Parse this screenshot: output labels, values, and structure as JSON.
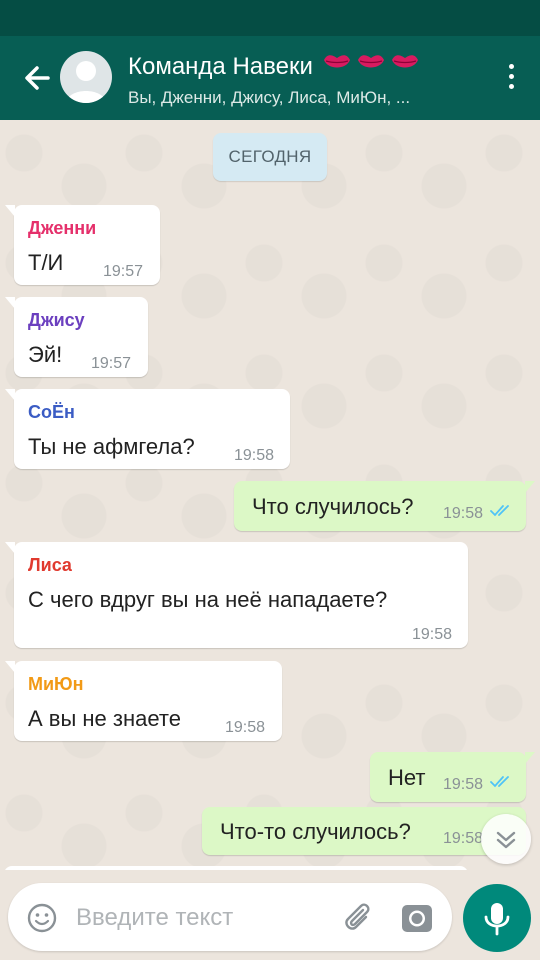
{
  "header": {
    "title": "Команда Навеки",
    "subtitle": "Вы, Дженни, Джису, Лиса, МиЮн, ...",
    "back_icon": "arrow-left-icon",
    "avatar_icon": "group-avatar-icon",
    "menu_icon": "more-vertical-icon",
    "title_emoji_icon": "kiss-lips-icon"
  },
  "chat": {
    "date_label": "СЕГОДНЯ",
    "messages": [
      {
        "sender": "Дженни",
        "sender_color": "#e5306b",
        "text": "Т/И",
        "time": "19:57",
        "direction": "in"
      },
      {
        "sender": "Джису",
        "sender_color": "#6b3fbf",
        "text": "Эй!",
        "time": "19:57",
        "direction": "in"
      },
      {
        "sender": "СоЁн",
        "sender_color": "#3b5cc4",
        "text": "Ты не афмгела?",
        "time": "19:58",
        "direction": "in"
      },
      {
        "text": "Что случилось?",
        "time": "19:58",
        "direction": "out",
        "status": "read"
      },
      {
        "sender": "Лиса",
        "sender_color": "#e03a2f",
        "text": "С чего вдруг вы на неё нападаете?",
        "time": "19:58",
        "direction": "in"
      },
      {
        "sender": "МиЮн",
        "sender_color": "#f29a16",
        "text": "А вы не знаете",
        "time": "19:58",
        "direction": "in"
      },
      {
        "text": "Нет",
        "time": "19:58",
        "direction": "out",
        "status": "read"
      },
      {
        "text": "Что-то случилось?",
        "time": "19:58",
        "direction": "out",
        "status": "read"
      }
    ]
  },
  "input": {
    "placeholder": "Введите текст",
    "value": "",
    "emoji_icon": "emoji-icon",
    "attach_icon": "paperclip-icon",
    "camera_icon": "camera-icon",
    "mic_icon": "microphone-icon",
    "scroll_icon": "double-chevron-down-icon"
  },
  "colors": {
    "app_bar": "#075e54",
    "status_bar": "#054d44",
    "outgoing_bubble": "#dcf8c6",
    "incoming_bubble": "#ffffff",
    "date_chip": "#d5eaf3",
    "read_ticks": "#4fc3f7",
    "mic_button": "#00897b"
  }
}
